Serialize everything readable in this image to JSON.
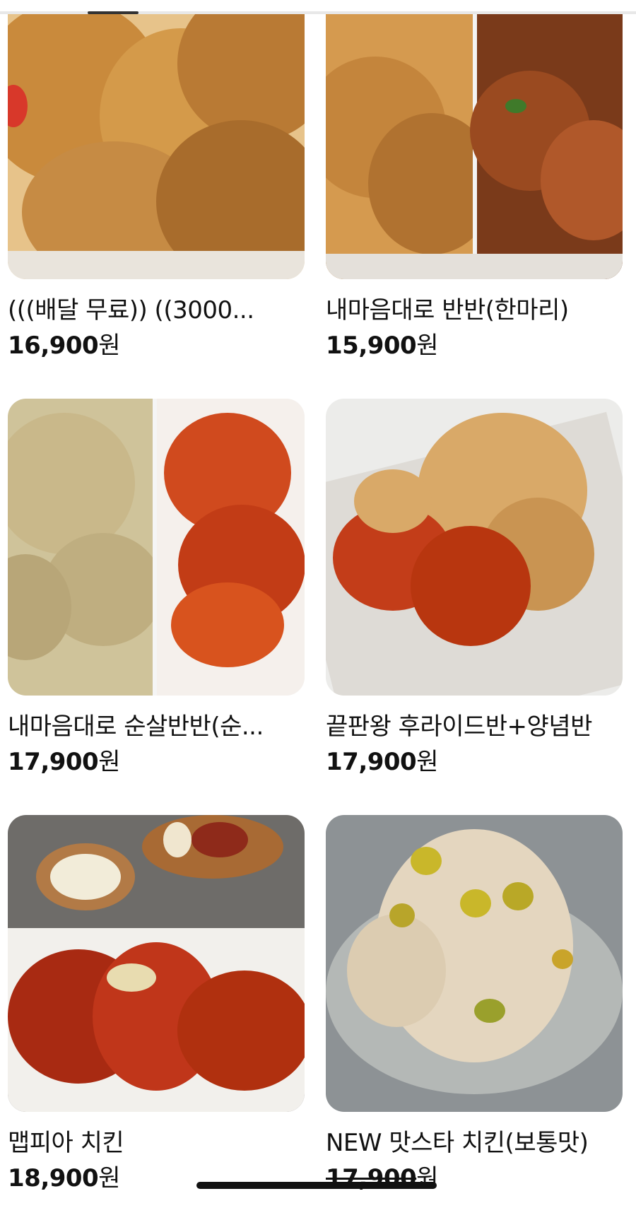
{
  "menu_items": [
    {
      "name": "(((배달 무료)) ((3000...",
      "price": "16,900",
      "unit": "원",
      "image": "fried-chicken-platter"
    },
    {
      "name": "내마음대로 반반(한마리)",
      "price": "15,900",
      "unit": "원",
      "image": "half-fried-half-spicy-chicken"
    },
    {
      "name": "내마음대로 순살반반(순...",
      "price": "17,900",
      "unit": "원",
      "image": "boneless-herb-and-spicy-chicken"
    },
    {
      "name": "끝판왕 후라이드반+양념반",
      "price": "17,900",
      "unit": "원",
      "image": "fried-and-yangnyeom-chicken"
    },
    {
      "name": "맵피아 치킨",
      "price": "18,900",
      "unit": "원",
      "image": "spicy-chicken-with-sausages"
    },
    {
      "name": "NEW 맛스타 치킨(보통맛)",
      "price": "17,900",
      "unit": "원",
      "image": "cream-sauce-chicken-with-jalapenos"
    }
  ],
  "colors": {
    "text": "#111111",
    "background": "#ffffff"
  }
}
